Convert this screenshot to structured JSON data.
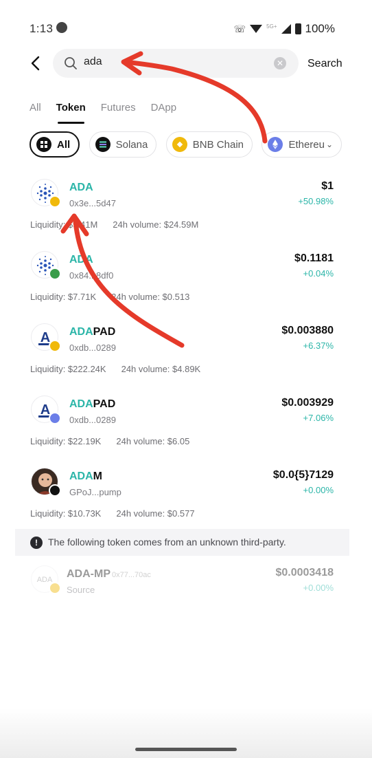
{
  "status_bar": {
    "time": "1:13",
    "network_label": "5G+",
    "battery": "100%"
  },
  "search": {
    "value": "ada",
    "button_label": "Search"
  },
  "tabs": [
    {
      "label": "All",
      "active": false
    },
    {
      "label": "Token",
      "active": true
    },
    {
      "label": "Futures",
      "active": false
    },
    {
      "label": "DApp",
      "active": false
    }
  ],
  "chains": [
    {
      "label": "All",
      "active": true,
      "icon": "grid-icon",
      "color": "#111111"
    },
    {
      "label": "Solana",
      "active": false,
      "icon": "solana-icon",
      "color": "#111111"
    },
    {
      "label": "BNB Chain",
      "active": false,
      "icon": "bnb-icon",
      "color": "#f0b90b"
    },
    {
      "label": "Ethereu",
      "active": false,
      "icon": "ethereum-icon",
      "color": "#6b7ee8"
    }
  ],
  "tokens": [
    {
      "name_hl": "ADA",
      "name_rest": "",
      "address": "0x3e...5d47",
      "price": "$1",
      "change": "+50.98%",
      "liquidity": "Liquidity: $9.41M",
      "volume": "24h volume: $24.59M",
      "logo": "cardano-logo-icon",
      "badge": "bnb-badge-icon"
    },
    {
      "name_hl": "ADA",
      "name_rest": "",
      "address": "0x84...8df0",
      "price": "$0.1181",
      "change": "+0.04%",
      "liquidity": "Liquidity: $7.71K",
      "volume": "24h volume: $0.513",
      "logo": "cardano-logo-icon",
      "badge": "heco-badge-icon"
    },
    {
      "name_hl": "ADA",
      "name_rest": "PAD",
      "address": "0xdb...0289",
      "price": "$0.003880",
      "change": "+6.37%",
      "liquidity": "Liquidity: $222.24K",
      "volume": "24h volume: $4.89K",
      "logo": "adapad-logo-icon",
      "badge": "bnb-badge-icon"
    },
    {
      "name_hl": "ADA",
      "name_rest": "PAD",
      "address": "0xdb...0289",
      "price": "$0.003929",
      "change": "+7.06%",
      "liquidity": "Liquidity: $22.19K",
      "volume": "24h volume: $6.05",
      "logo": "adapad-logo-icon",
      "badge": "ethereum-badge-icon"
    },
    {
      "name_hl": "ADA",
      "name_rest": "M",
      "address": "GPoJ...pump",
      "price": "$0.0{5}7129",
      "change": "+0.00%",
      "liquidity": "Liquidity: $10.73K",
      "volume": "24h volume: $0.577",
      "logo": "adam-avatar-icon",
      "badge": "solana-badge-icon"
    }
  ],
  "notice": {
    "text": "The following token comes from an unknown third-party."
  },
  "unknown_token": {
    "name": "ADA-MP",
    "address": "0x77...70ac",
    "source": "Source",
    "logo_text": "ADA",
    "price": "$0.0003418",
    "change": "+0.00%"
  },
  "colors": {
    "accent": "#2bb5a8",
    "annotation_arrow": "#e53a2a"
  }
}
